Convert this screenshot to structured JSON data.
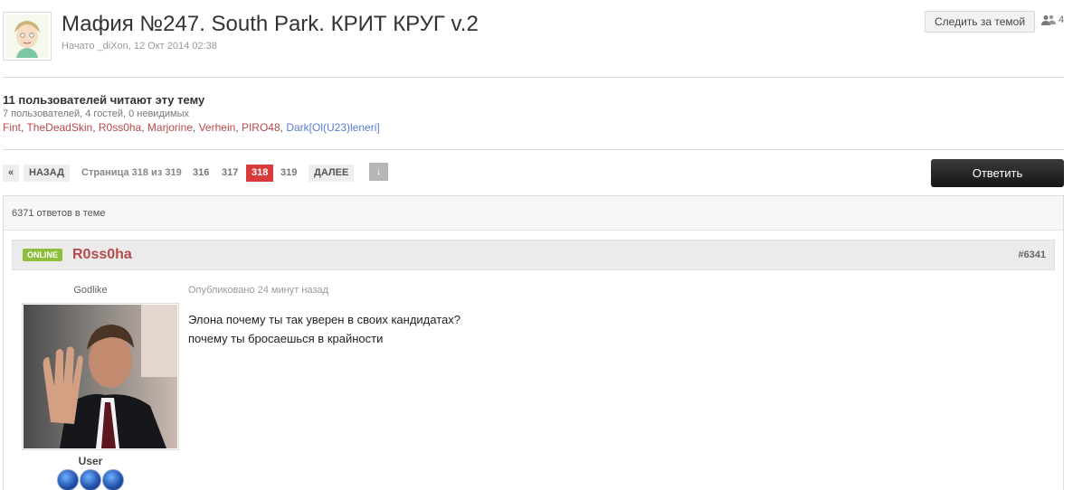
{
  "topic": {
    "title": "Мафия №247. South Park. КРИТ КРУГ v.2",
    "started_by": "Начато _diXon, 12 Окт 2014 02:38",
    "follow_label": "Следить за темой",
    "followers_count": "4"
  },
  "readers": {
    "title": "11 пользователей читают эту тему",
    "summary": "7 пользователей, 4 гостей, 0 невидимых",
    "users": [
      "Fint",
      "TheDeadSkin",
      "R0ss0ha",
      "Marjorine",
      "Verhein",
      "PIRO48",
      "Dark[Ol(U23)leneri]"
    ],
    "separator": ", "
  },
  "pagination": {
    "first": "«",
    "prev": "НАЗАД",
    "page_info": "Страница 318 из 319",
    "pages": [
      "316",
      "317",
      "318",
      "319"
    ],
    "current": "318",
    "next": "ДАЛЕЕ",
    "jump": "↓"
  },
  "reply_label": "Ответить",
  "replies_count": "6371 ответов в теме",
  "post": {
    "status": "ONLINE",
    "author": "R0ss0ha",
    "number": "#6341",
    "group": "Godlike",
    "rank": "User",
    "date": "Опубликовано 24 минут назад",
    "lines": [
      "Элона почему ты так уверен в своих кандидатах?",
      "почему ты бросаешься в крайности"
    ]
  },
  "colors": {
    "username": "#b8494a",
    "username_alt": "#5a7bd0",
    "current_page": "#d93a3a",
    "online_badge": "#8dbf3d"
  }
}
